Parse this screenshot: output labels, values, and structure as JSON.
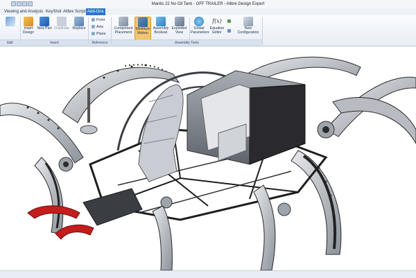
{
  "window": {
    "title": "Mantis 22 No Oil Tank - OFF TRAILER - Alibre Design Expert"
  },
  "menu": [
    "Viewing and Analysis",
    "KeyShot",
    "Alibre Script",
    "Add-Ons"
  ],
  "ribbon": {
    "groups": {
      "edit": "Edit",
      "insert": "Insert",
      "reference": "Reference",
      "assembly_tools": "Assembly Tools"
    },
    "insert": {
      "insert_design": "Insert Design",
      "new_part": "New Part",
      "duplicate": "Duplicate",
      "replace": "Replace"
    },
    "reference": {
      "point": "Point",
      "axis": "Axis",
      "plane": "Plane"
    },
    "assembly": {
      "component_placement": "Component Placement",
      "minimum_motion": "Minimum Motion",
      "assembly_boolean": "Assembly Boolean",
      "exploded_view": "Exploded View",
      "global_parameters": "Global Parameters",
      "equation_editor": "Equation Editor",
      "fx_symbol": "f(x)",
      "new_configuration": "New Configuration"
    }
  },
  "colors": {
    "frame": "#1d1d1d",
    "claw": "#c51c1c",
    "panel": "#c8ccd2",
    "dark_panel": "#2a2a2e",
    "highlight": "#f5c46f"
  },
  "icons": [
    "edit-icon",
    "insert-design-icon",
    "new-part-icon",
    "duplicate-icon",
    "replace-icon",
    "point-icon",
    "axis-icon",
    "plane-icon",
    "component-placement-icon",
    "minimum-motion-icon",
    "assembly-boolean-icon",
    "exploded-view-icon",
    "global-parameters-icon",
    "equation-editor-icon",
    "new-configuration-icon"
  ]
}
